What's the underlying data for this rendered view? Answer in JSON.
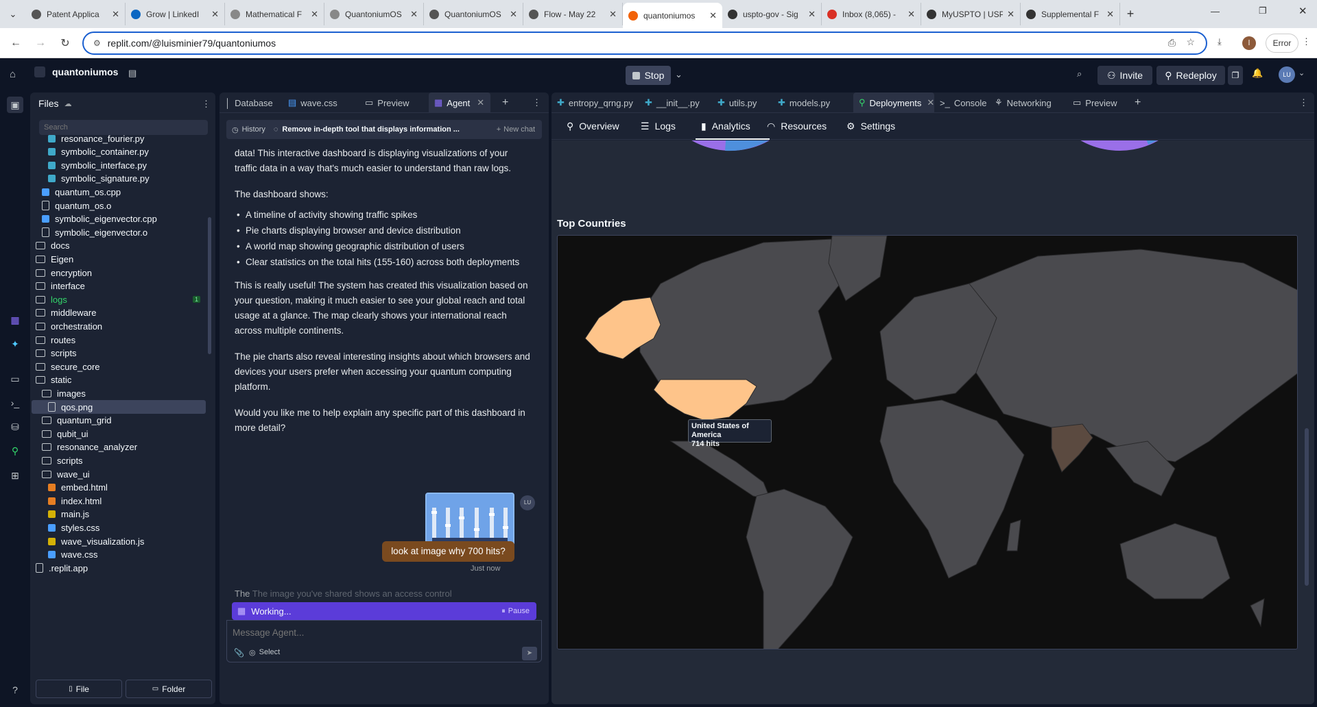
{
  "browser": {
    "tabs": [
      {
        "title": "Patent Applica",
        "fav": "#555",
        "icon": "github-icon"
      },
      {
        "title": "Grow | LinkedI",
        "fav": "#0a66c2",
        "icon": "linkedin-icon"
      },
      {
        "title": "Mathematical F",
        "fav": "#888",
        "icon": "zenodo-icon"
      },
      {
        "title": "QuantoniumOS",
        "fav": "#888",
        "icon": "zenodo-icon"
      },
      {
        "title": "QuantoniumOS",
        "fav": "#555",
        "icon": "globe-icon"
      },
      {
        "title": "Flow - May 22",
        "fav": "#555",
        "icon": "flow-icon"
      },
      {
        "title": "quantoniumos",
        "fav": "#f26207",
        "icon": "replit-icon"
      },
      {
        "title": "uspto-gov - Sig",
        "fav": "#333",
        "icon": "uspto-icon"
      },
      {
        "title": "Inbox (8,065) -",
        "fav": "#d93025",
        "icon": "gmail-icon"
      },
      {
        "title": "MyUSPTO | USP",
        "fav": "#333",
        "icon": "uspto-icon"
      },
      {
        "title": "Supplemental F",
        "fav": "#333",
        "icon": "uspto-icon"
      }
    ],
    "url": "replit.com/@luisminier79/quantoniumos",
    "error_label": "Error",
    "profile_initial": "l"
  },
  "topbar": {
    "project": "quantoniumos",
    "stop": "Stop",
    "invite": "Invite",
    "redeploy": "Redeploy",
    "avatar": "LU"
  },
  "files": {
    "title": "Files",
    "search_placeholder": "Search",
    "items": [
      {
        "name": "resonance_fourier.py",
        "indent": 2,
        "type": "py"
      },
      {
        "name": "symbolic_container.py",
        "indent": 2,
        "type": "py"
      },
      {
        "name": "symbolic_interface.py",
        "indent": 2,
        "type": "py"
      },
      {
        "name": "symbolic_signature.py",
        "indent": 2,
        "type": "py"
      },
      {
        "name": "quantum_os.cpp",
        "indent": 1,
        "type": "cpp"
      },
      {
        "name": "quantum_os.o",
        "indent": 1,
        "type": "file"
      },
      {
        "name": "symbolic_eigenvector.cpp",
        "indent": 1,
        "type": "cpp"
      },
      {
        "name": "symbolic_eigenvector.o",
        "indent": 1,
        "type": "file"
      },
      {
        "name": "docs",
        "indent": 0,
        "type": "folder"
      },
      {
        "name": "Eigen",
        "indent": 0,
        "type": "folder"
      },
      {
        "name": "encryption",
        "indent": 0,
        "type": "folder"
      },
      {
        "name": "interface",
        "indent": 0,
        "type": "folder"
      },
      {
        "name": "logs",
        "indent": 0,
        "type": "folder",
        "badge": "1",
        "green": true
      },
      {
        "name": "middleware",
        "indent": 0,
        "type": "folder"
      },
      {
        "name": "orchestration",
        "indent": 0,
        "type": "folder"
      },
      {
        "name": "routes",
        "indent": 0,
        "type": "folder"
      },
      {
        "name": "scripts",
        "indent": 0,
        "type": "folder"
      },
      {
        "name": "secure_core",
        "indent": 0,
        "type": "folder"
      },
      {
        "name": "static",
        "indent": 0,
        "type": "folder"
      },
      {
        "name": "images",
        "indent": 1,
        "type": "folder"
      },
      {
        "name": "qos.png",
        "indent": 2,
        "type": "img",
        "selected": true
      },
      {
        "name": "quantum_grid",
        "indent": 1,
        "type": "folder"
      },
      {
        "name": "qubit_ui",
        "indent": 1,
        "type": "folder"
      },
      {
        "name": "resonance_analyzer",
        "indent": 1,
        "type": "folder"
      },
      {
        "name": "scripts",
        "indent": 1,
        "type": "folder"
      },
      {
        "name": "wave_ui",
        "indent": 1,
        "type": "folder"
      },
      {
        "name": "embed.html",
        "indent": 2,
        "type": "html"
      },
      {
        "name": "index.html",
        "indent": 2,
        "type": "html"
      },
      {
        "name": "main.js",
        "indent": 2,
        "type": "js"
      },
      {
        "name": "styles.css",
        "indent": 2,
        "type": "css"
      },
      {
        "name": "wave_visualization.js",
        "indent": 2,
        "type": "js"
      },
      {
        "name": "wave.css",
        "indent": 2,
        "type": "css"
      },
      {
        "name": ".replit.app",
        "indent": 0,
        "type": "file"
      }
    ],
    "new_file": "File",
    "new_folder": "Folder"
  },
  "agent": {
    "tabs": [
      "Database",
      "wave.css",
      "Preview",
      "Agent"
    ],
    "history": "History",
    "chat_title": "Remove in-depth tool that displays information ...",
    "new_chat": "New chat",
    "para1": "data! This interactive dashboard is displaying visualizations of your traffic data in a way that's much easier to understand than raw logs.",
    "para2": "The dashboard shows:",
    "bullets": [
      "A timeline of activity showing traffic spikes",
      "Pie charts displaying browser and device distribution",
      "A world map showing geographic distribution of users",
      "Clear statistics on the total hits (155-160) across both deployments"
    ],
    "para3": "This is really useful! The system has created this visualization based on your question, making it much easier to see your global reach and total usage at a glance. The map clearly shows your international reach across multiple continents.",
    "para4": "The pie charts also reveal interesting insights about which browsers and devices your users prefer when accessing your quantum computing platform.",
    "para5": "Would you like me to help explain any specific part of this dashboard in more detail?",
    "user_msg": "look at image why 700 hits?",
    "user_time": "Just now",
    "user_avatar": "LU",
    "streaming_dim": "The image you've shared shows an access control",
    "streaming_first": "The",
    "working": "Working...",
    "pause": "Pause",
    "input_placeholder": "Message Agent...",
    "select": "Select"
  },
  "deploy": {
    "tabs": [
      "entropy_qrng.py",
      "__init__.py",
      "utils.py",
      "models.py",
      "Deployments",
      "Console",
      "Networking",
      "Preview"
    ],
    "subtabs": [
      "Overview",
      "Logs",
      "Analytics",
      "Resources",
      "Settings"
    ],
    "section": "Top Countries",
    "tooltip_country": "United States of America",
    "tooltip_hits": "714 hits",
    "colors": {
      "highlight": "#fec48a",
      "india": "#5b4a40",
      "land": "#4a4a4e",
      "ocean": "#0f0f0f"
    }
  }
}
